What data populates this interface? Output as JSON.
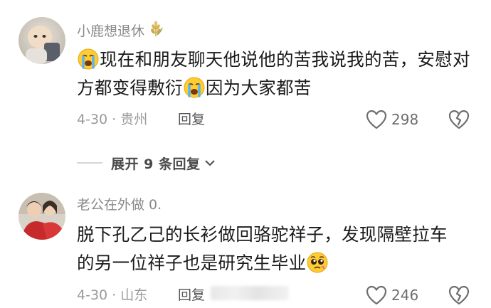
{
  "comments": [
    {
      "username": "小鹿想退休",
      "badge_icon": "wheat-icon",
      "text_part1": "现在和朋友聊天他说他的苦我说我的苦，安慰对方都变得敷衍",
      "text_part2": "因为大家都苦",
      "location": "4-30 · 贵州",
      "reply_label": "回复",
      "likes": "298"
    },
    {
      "username": "老公在外做 0.",
      "text_line1": "脱下孔乙己的长衫做回骆驼祥子，发现隔壁拉车",
      "text_line2": "的另一位祥子也是研究生毕业",
      "location": "4-30 · 山东",
      "reply_label": "回复",
      "likes": "246"
    }
  ],
  "expand_replies": {
    "label": "展开 9 条回复"
  },
  "colors": {
    "meta": "#9a9a9a",
    "text": "#1a1a1a",
    "icon": "#6e6e6e"
  }
}
